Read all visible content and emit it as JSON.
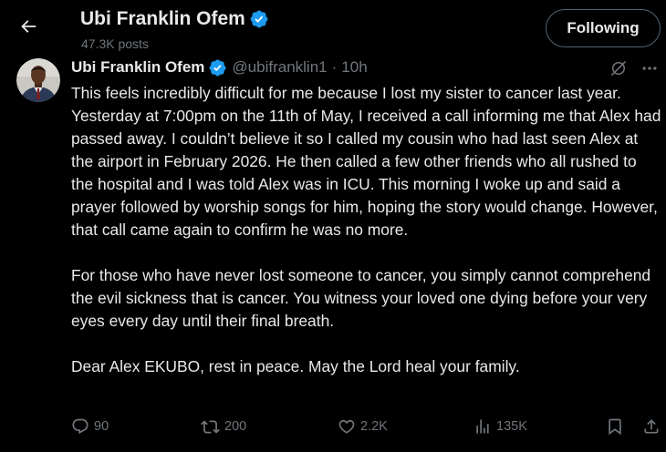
{
  "header": {
    "back_label": "Back",
    "name": "Ubi Franklin Ofem",
    "posts_count": "47.3K posts",
    "follow_label": "Following"
  },
  "post": {
    "author_name": "Ubi Franklin Ofem",
    "author_handle": "@ubifranklin1",
    "separator": "·",
    "time": "10h",
    "paragraphs": [
      "This feels incredibly difficult for me because I lost my sister to cancer last year. Yesterday at 7:00pm on the 11th of May, I received a call informing me that Alex had passed away. I couldn’t believe it so I called my cousin who had last seen Alex at the airport in February 2026. He then called a few other friends who all rushed to the hospital and I was told Alex was in ICU. This morning I woke up and said a prayer followed by worship songs for him, hoping the story would change. However, that call came again to confirm he was no more.",
      "For those who have never lost someone to cancer, you simply cannot comprehend the evil sickness that is cancer. You witness your loved one dying before your very eyes every day until their final breath.",
      "Dear Alex EKUBO, rest in peace. May the Lord heal your family."
    ]
  },
  "actions": {
    "replies": "90",
    "reposts": "200",
    "likes": "2.2K",
    "views": "135K"
  },
  "icons": {
    "back": "arrow-left-icon",
    "verified": "verified-badge-icon",
    "grok": "grok-icon",
    "more": "more-horizontal-icon",
    "reply": "reply-icon",
    "repost": "repost-icon",
    "like": "heart-icon",
    "views": "views-icon",
    "bookmark": "bookmark-icon",
    "share": "share-icon"
  },
  "colors": {
    "background": "#000000",
    "text_primary": "#e7e9ea",
    "text_secondary": "#71767b",
    "verified_blue": "#1d9bf0",
    "button_border": "#536471"
  }
}
